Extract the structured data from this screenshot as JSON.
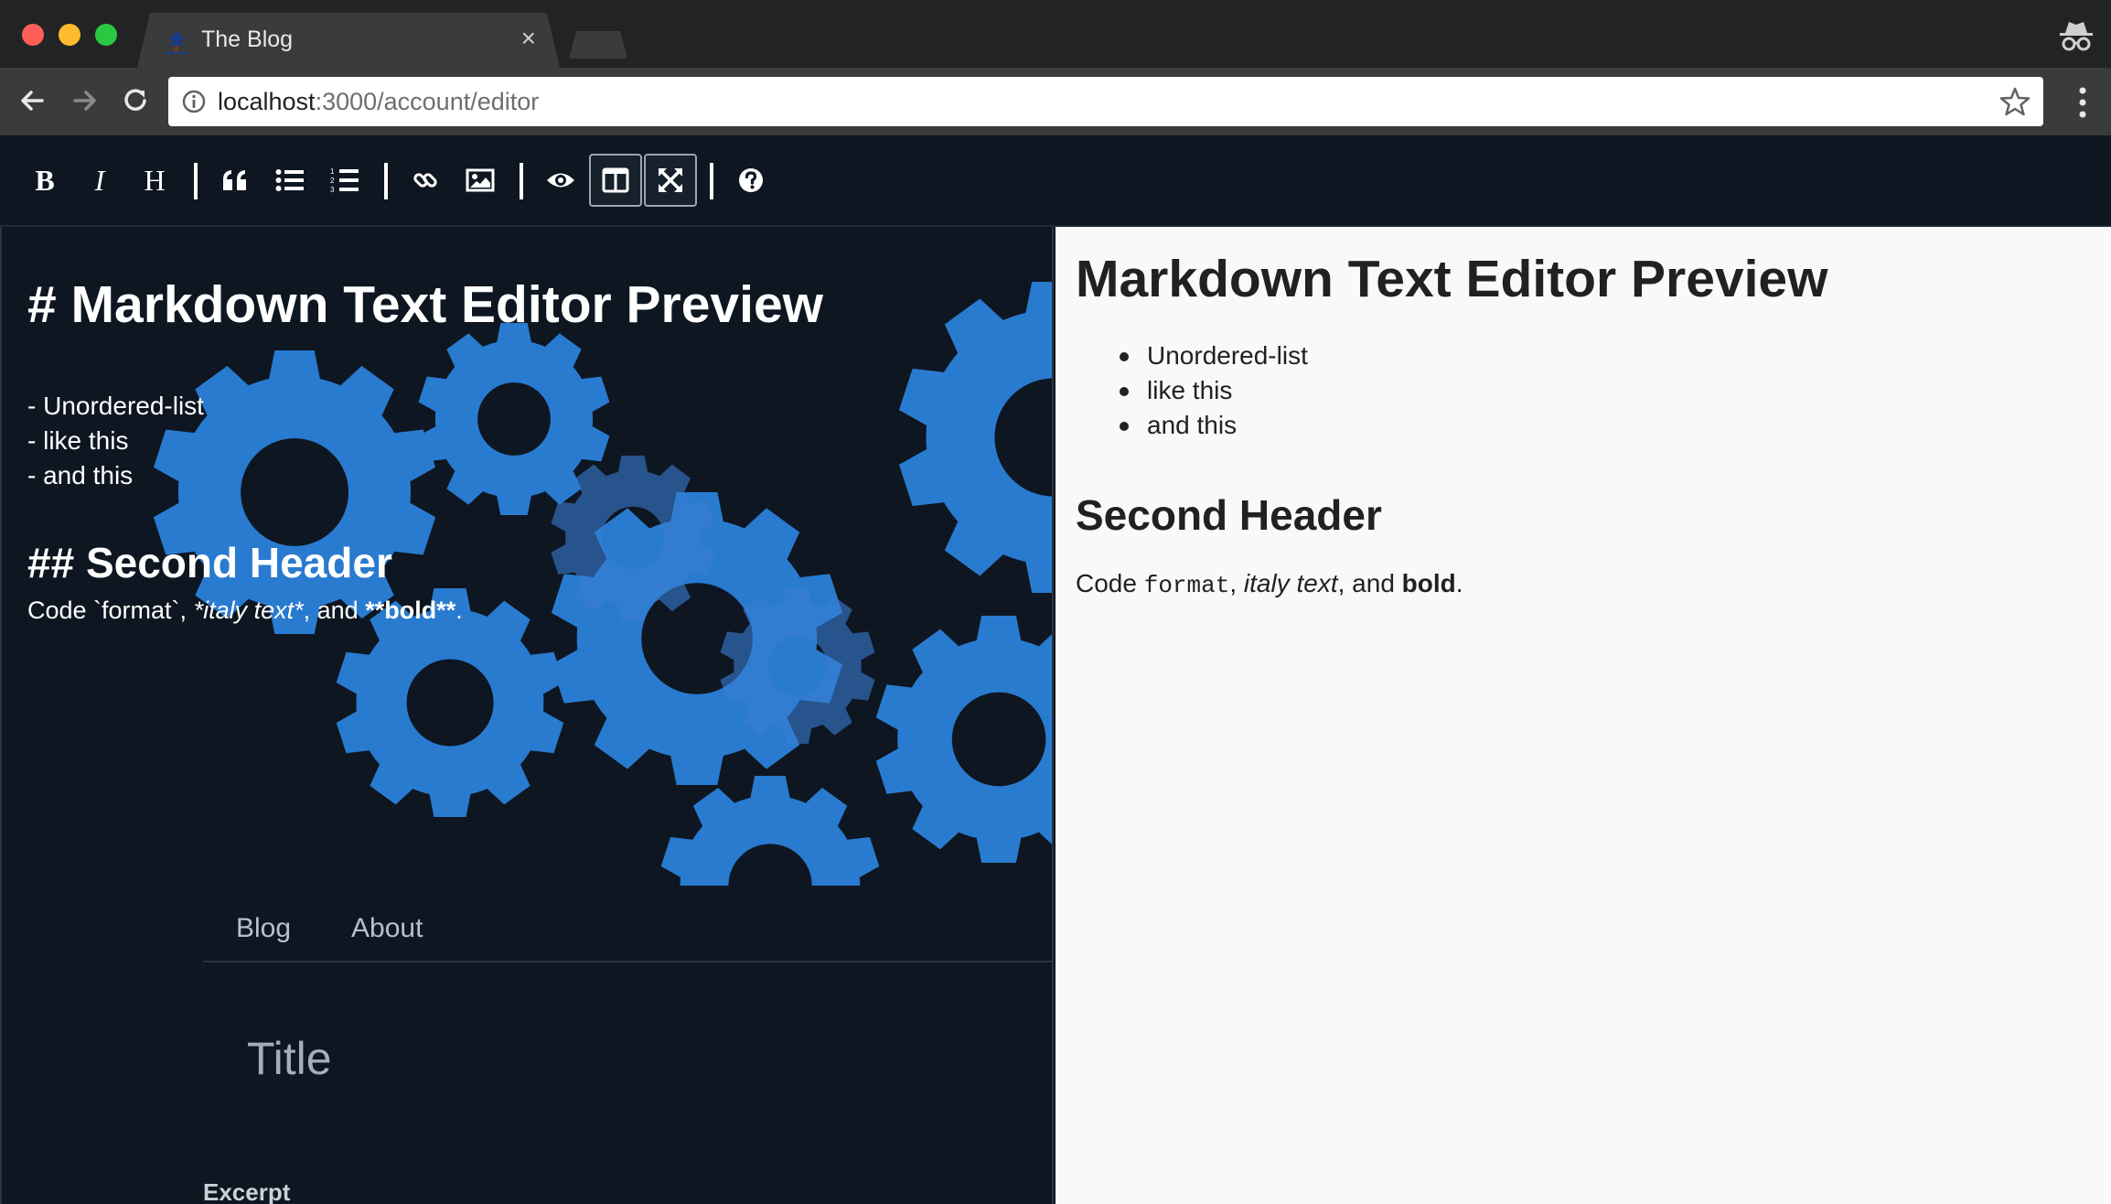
{
  "browser": {
    "tab_title": "The Blog",
    "tab_close": "×",
    "url_host": "localhost",
    "url_rest": ":3000/account/editor"
  },
  "editor_toolbar": {
    "bold_label": "B",
    "italic_label": "I",
    "heading_label": "H",
    "icons": [
      "bold",
      "italic",
      "heading",
      "quote",
      "unordered-list",
      "ordered-list",
      "link",
      "image",
      "preview",
      "side-by-side",
      "fullscreen",
      "help"
    ],
    "active": [
      "side-by-side",
      "fullscreen"
    ]
  },
  "markdown_source": {
    "h1": "# Markdown Text Editor Preview",
    "list": [
      "- Unordered-list",
      "- like this",
      "- and this"
    ],
    "h2": "## Second Header",
    "para_prefix": "Code `format`, ",
    "para_italic": "*italy text*",
    "para_mid": ", and ",
    "para_bold": "**bold**",
    "para_suffix": "."
  },
  "site_behind": {
    "nav": [
      "Blog",
      "About"
    ],
    "title_placeholder": "Title",
    "excerpt_label": "Excerpt"
  },
  "preview": {
    "h1": "Markdown Text Editor Preview",
    "list": [
      "Unordered-list",
      "like this",
      "and this"
    ],
    "h2": "Second Header",
    "para_prefix": "Code ",
    "para_code": "format",
    "para_sep": ", ",
    "para_italic": "italy text",
    "para_mid": ", and ",
    "para_bold": "bold",
    "para_suffix": "."
  },
  "colors": {
    "editor_bg": "#0e1621",
    "gear_blue": "#2f8ef0",
    "preview_bg": "#f9f9f9",
    "chrome_dark": "#222324",
    "chrome_toolbar": "#3a3b3c"
  }
}
